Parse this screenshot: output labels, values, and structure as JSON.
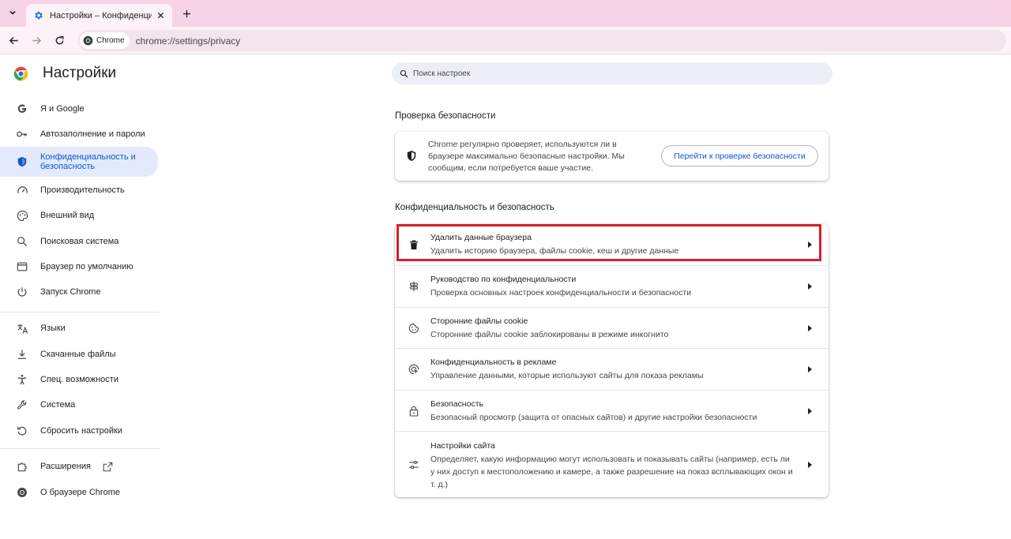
{
  "browser": {
    "tab_title": "Настройки – Конфиденциально",
    "chip_label": "Chrome",
    "url": "chrome://settings/privacy"
  },
  "sidebar": {
    "title": "Настройки",
    "items": [
      {
        "label": "Я и Google",
        "icon": "google-g-icon"
      },
      {
        "label": "Автозаполнение и пароли",
        "icon": "key-icon"
      },
      {
        "label": "Конфиденциальность и безопасность",
        "icon": "shield-icon",
        "active": true
      },
      {
        "label": "Производительность",
        "icon": "speedometer-icon"
      },
      {
        "label": "Внешний вид",
        "icon": "palette-icon"
      },
      {
        "label": "Поисковая система",
        "icon": "search-icon"
      },
      {
        "label": "Браузер по умолчанию",
        "icon": "browser-window-icon"
      },
      {
        "label": "Запуск Chrome",
        "icon": "power-icon"
      },
      {
        "label": "Языки",
        "icon": "translate-icon"
      },
      {
        "label": "Скачанные файлы",
        "icon": "download-icon"
      },
      {
        "label": "Спец. возможности",
        "icon": "accessibility-icon"
      },
      {
        "label": "Система",
        "icon": "wrench-icon"
      },
      {
        "label": "Сбросить настройки",
        "icon": "reset-icon"
      },
      {
        "label": "Расширения",
        "icon": "puzzle-icon"
      },
      {
        "label": "О браузере Chrome",
        "icon": "chrome-icon"
      }
    ]
  },
  "search": {
    "placeholder": "Поиск настроек"
  },
  "safety_check": {
    "section_title": "Проверка безопасности",
    "text": "Chrome регулярно проверяет, используются ли в браузере максимально безопасные настройки. Мы сообщим, если потребуется ваше участие.",
    "button": "Перейти к проверке безопасности"
  },
  "privacy": {
    "section_title": "Конфиденциальность и безопасность",
    "rows": [
      {
        "title": "Удалить данные браузера",
        "subtitle": "Удалить историю браузера, файлы cookie, кеш и другие данные",
        "icon": "trash-icon"
      },
      {
        "title": "Руководство по конфиденциальности",
        "subtitle": "Проверка основных настроек конфиденциальности и безопасности",
        "icon": "signpost-icon"
      },
      {
        "title": "Сторонние файлы cookie",
        "subtitle": "Сторонние файлы cookie заблокированы в режиме инкогнито",
        "icon": "cookie-icon"
      },
      {
        "title": "Конфиденциальность в рекламе",
        "subtitle": "Управление данными, которые используют сайты для показа рекламы",
        "icon": "ad-privacy-icon"
      },
      {
        "title": "Безопасность",
        "subtitle": "Безопасный просмотр (защита от опасных сайтов) и другие настройки безопасности",
        "icon": "lock-icon"
      },
      {
        "title": "Настройки сайта",
        "subtitle": "Определяет, какую информацию могут использовать и показывать сайты (например, есть ли у них доступ к местоположению и камере, а также разрешение на показ всплывающих окон и т. д.)",
        "icon": "sliders-icon"
      }
    ]
  },
  "colors": {
    "accent": "#0b57d0",
    "highlight": "#d3202f",
    "active_bg": "#e3eafd",
    "tabstrip": "#f7d3e6"
  }
}
